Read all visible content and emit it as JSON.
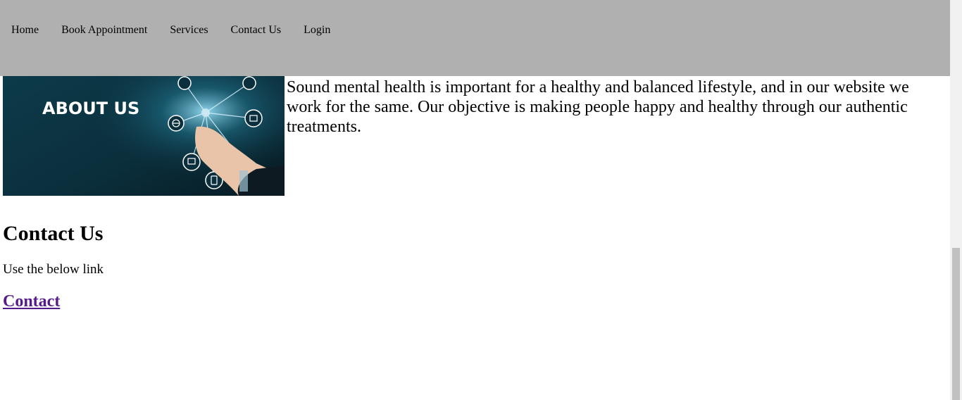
{
  "nav": {
    "items": [
      {
        "label": "Home"
      },
      {
        "label": "Book Appointment"
      },
      {
        "label": "Services"
      },
      {
        "label": "Contact Us"
      },
      {
        "label": "Login"
      }
    ],
    "background": "#b0b0b0"
  },
  "about": {
    "image_text": "ABOUT US",
    "paragraph": "Sound mental health is important for a healthy and balanced lifestyle, and in our website we work for the same. Our objective is making people happy and healthy through our authentic treatments."
  },
  "contact": {
    "heading": "Contact Us",
    "description": "Use the below link",
    "link_label": "Contact",
    "link_color": "#551a8b"
  }
}
